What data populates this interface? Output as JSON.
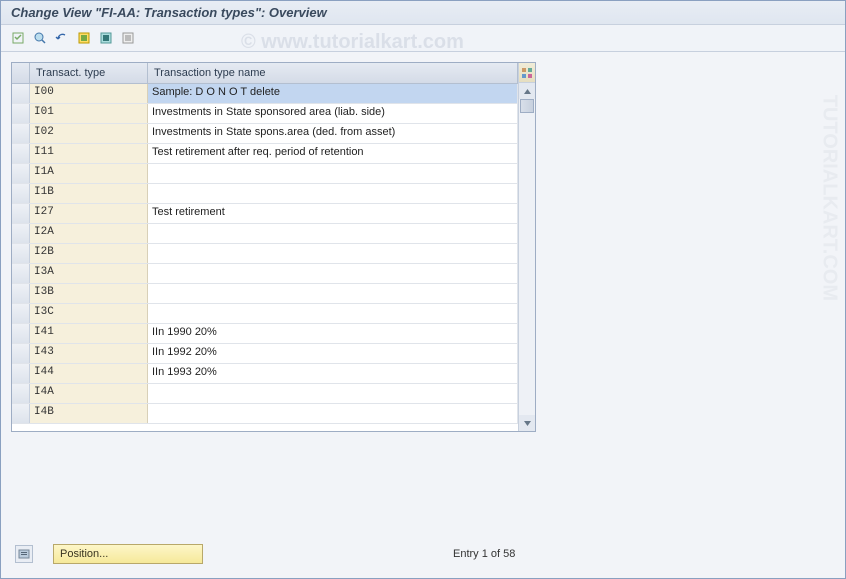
{
  "title": "Change View \"FI-AA: Transaction types\": Overview",
  "watermark": "© www.tutorialkart.com",
  "watermark_side": "TUTORIALKART.COM",
  "columns": {
    "type": "Transact. type",
    "name": "Transaction type name"
  },
  "rows": [
    {
      "type": "I00",
      "name": "Sample:  D O  N O T delete",
      "selected": true
    },
    {
      "type": "I01",
      "name": "Investments in State sponsored area (liab. side)"
    },
    {
      "type": "I02",
      "name": "Investments in State spons.area (ded. from asset)"
    },
    {
      "type": "I11",
      "name": "Test retirement after req. period of retention"
    },
    {
      "type": "I1A",
      "name": ""
    },
    {
      "type": "I1B",
      "name": ""
    },
    {
      "type": "I27",
      "name": "Test retirement"
    },
    {
      "type": "I2A",
      "name": ""
    },
    {
      "type": "I2B",
      "name": ""
    },
    {
      "type": "I3A",
      "name": ""
    },
    {
      "type": "I3B",
      "name": ""
    },
    {
      "type": "I3C",
      "name": ""
    },
    {
      "type": "I41",
      "name": "IIn 1990 20%"
    },
    {
      "type": "I43",
      "name": "IIn 1992 20%"
    },
    {
      "type": "I44",
      "name": "IIn 1993 20%"
    },
    {
      "type": "I4A",
      "name": ""
    },
    {
      "type": "I4B",
      "name": ""
    }
  ],
  "footer": {
    "position_label": "Position...",
    "entry_status": "Entry 1 of 58"
  }
}
